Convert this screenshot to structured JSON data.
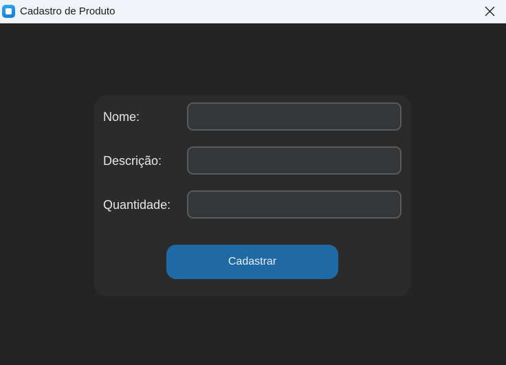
{
  "window": {
    "title": "Cadastro de Produto"
  },
  "form": {
    "fields": [
      {
        "label": "Nome:",
        "value": "",
        "placeholder": ""
      },
      {
        "label": "Descrição:",
        "value": "",
        "placeholder": ""
      },
      {
        "label": "Quantidade:",
        "value": "",
        "placeholder": ""
      }
    ],
    "submit_label": "Cadastrar"
  },
  "colors": {
    "background": "#242424",
    "frame": "#2b2b2b",
    "entry_bg": "#343638",
    "entry_border": "#565b5e",
    "button": "#1f6aa5",
    "titlebar": "#f0f4f9"
  },
  "icons": {
    "app": "app-icon",
    "close": "close-icon"
  }
}
